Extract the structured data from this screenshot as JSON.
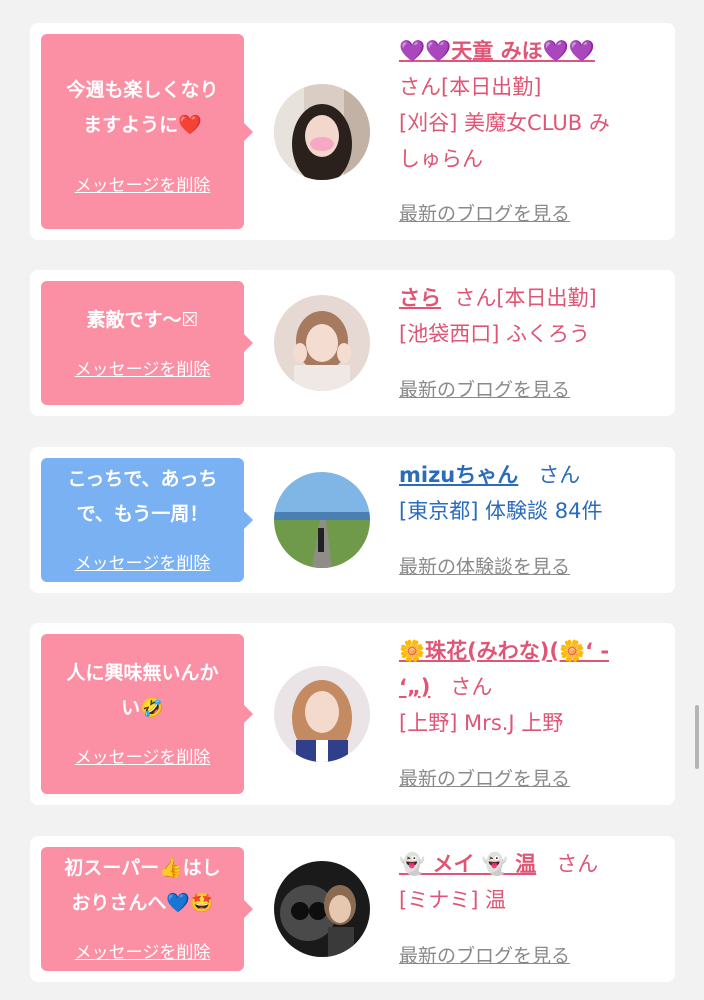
{
  "colors": {
    "page_bg": "#f2f2f2",
    "bubble_pink": "#fb8fa4",
    "bubble_blue": "#7ab1f3",
    "text_pink": "#e05575",
    "text_blue": "#2a6bbd",
    "link_gray": "#8a8a8a"
  },
  "cards": [
    {
      "message_line1": "今週も楽しくなり",
      "message_line2": "ますように❤️",
      "delete_label": "メッセージを削除",
      "name": "💜💜天童 みほ💜💜",
      "info_line1": "さん[本日出勤]",
      "info_line2": "[刈谷] 美魔女CLUB み",
      "info_line3": "しゅらん",
      "more_label": "最新のブログを見る"
    },
    {
      "message_line1": "素敵です〜☒",
      "delete_label": "メッセージを削除",
      "name": "さら",
      "name_suffix": "さん[本日出勤]",
      "info_line2": "[池袋西口] ふくろう",
      "more_label": "最新のブログを見る"
    },
    {
      "message_line1": "こっちで、あっち",
      "message_line2": "で、もう一周！",
      "delete_label": "メッセージを削除",
      "name": "mizuちゃん",
      "name_suffix": "さん",
      "info_line2": "[東京都] 体験談 84件",
      "more_label": "最新の体験談を見る"
    },
    {
      "message_line1": "人に興味無いんか",
      "message_line2": "い🤣",
      "delete_label": "メッセージを削除",
      "name_line1": "🌼珠花(みわな)(🌼‘ -",
      "name_line2": "‘„)",
      "name_suffix": "さん",
      "info_line2": "[上野] Mrs.J 上野",
      "more_label": "最新のブログを見る"
    },
    {
      "message_line1": "初スーパー👍はし",
      "message_line2": "おりさんへ💙🤩",
      "delete_label": "メッセージを削除",
      "name": "👻 メイ 👻 温",
      "name_suffix": "さん",
      "info_line2": "[ミナミ] 温",
      "more_label": "最新のブログを見る"
    }
  ]
}
